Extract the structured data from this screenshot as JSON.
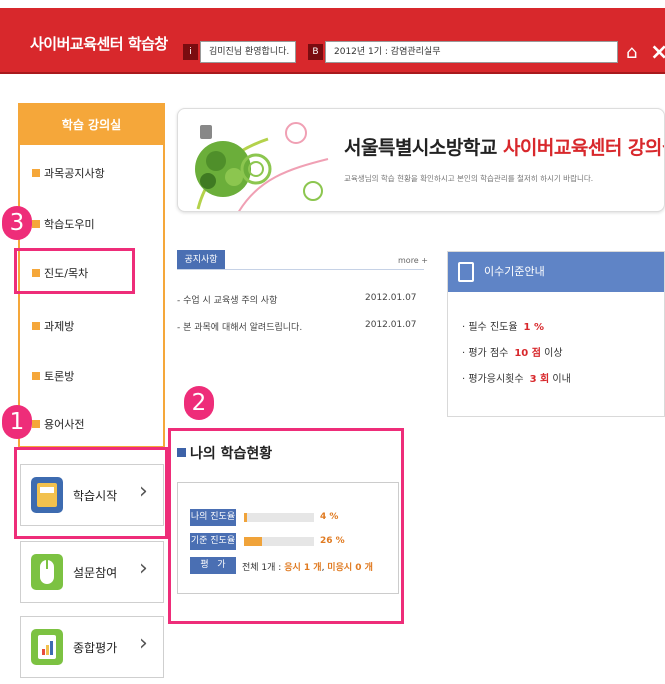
{
  "header": {
    "title": "사이버교육센터 학습창",
    "user_text": "김미진님 환영합니다.",
    "course_text": "2012년 1기 : 감염관리실무"
  },
  "sidebar": {
    "title": "학습 강의실",
    "items": [
      "과목공지사항",
      "학습도우미",
      "진도/목차",
      "과제방",
      "토론방",
      "용어사전"
    ],
    "buttons": [
      "학습시작",
      "설문참여",
      "종합평가"
    ]
  },
  "banner": {
    "title_dark": "서울특별시소방학교",
    "title_red": "사이버교육센터 강의실",
    "subtitle": "교육생님의 학습 현황을 확인하시고 본인의 학습관리를 철저히 하시기 바랍니다."
  },
  "notice": {
    "tab": "공지사항",
    "more": "more +",
    "rows": [
      {
        "title": "- 수업 시 교육생 주의 사항",
        "date": "2012.01.07"
      },
      {
        "title": "- 본 과목에 대해서 알려드립니다.",
        "date": "2012.01.07"
      }
    ]
  },
  "criteria": {
    "title": "이수기준안내",
    "rows": [
      {
        "label": "필수 진도율",
        "value": "1 %",
        "suffix": ""
      },
      {
        "label": "평가 점수",
        "value": "10 점",
        "suffix": "이상"
      },
      {
        "label": "평가응시횟수",
        "value": "3 회",
        "suffix": "이내"
      }
    ]
  },
  "status": {
    "title": "나의 학습현황",
    "my_progress_label": "나의 진도율",
    "my_progress": 4,
    "my_progress_text": "4 %",
    "standard_label": "기준 진도율",
    "standard_progress": 26,
    "standard_text": "26 %",
    "eval_label": "평   가",
    "eval_pre": "전체 1개 : ",
    "eval_taken": "응시 1 개",
    "eval_sep": ", ",
    "eval_untaken": "미응시 0 개"
  },
  "markers": [
    "1",
    "2",
    "3"
  ],
  "colors": {
    "header": "#d8282c",
    "sidebar_accent": "#f5a73a",
    "blue": "#4a6fb3",
    "highlight": "#ee2d79"
  }
}
